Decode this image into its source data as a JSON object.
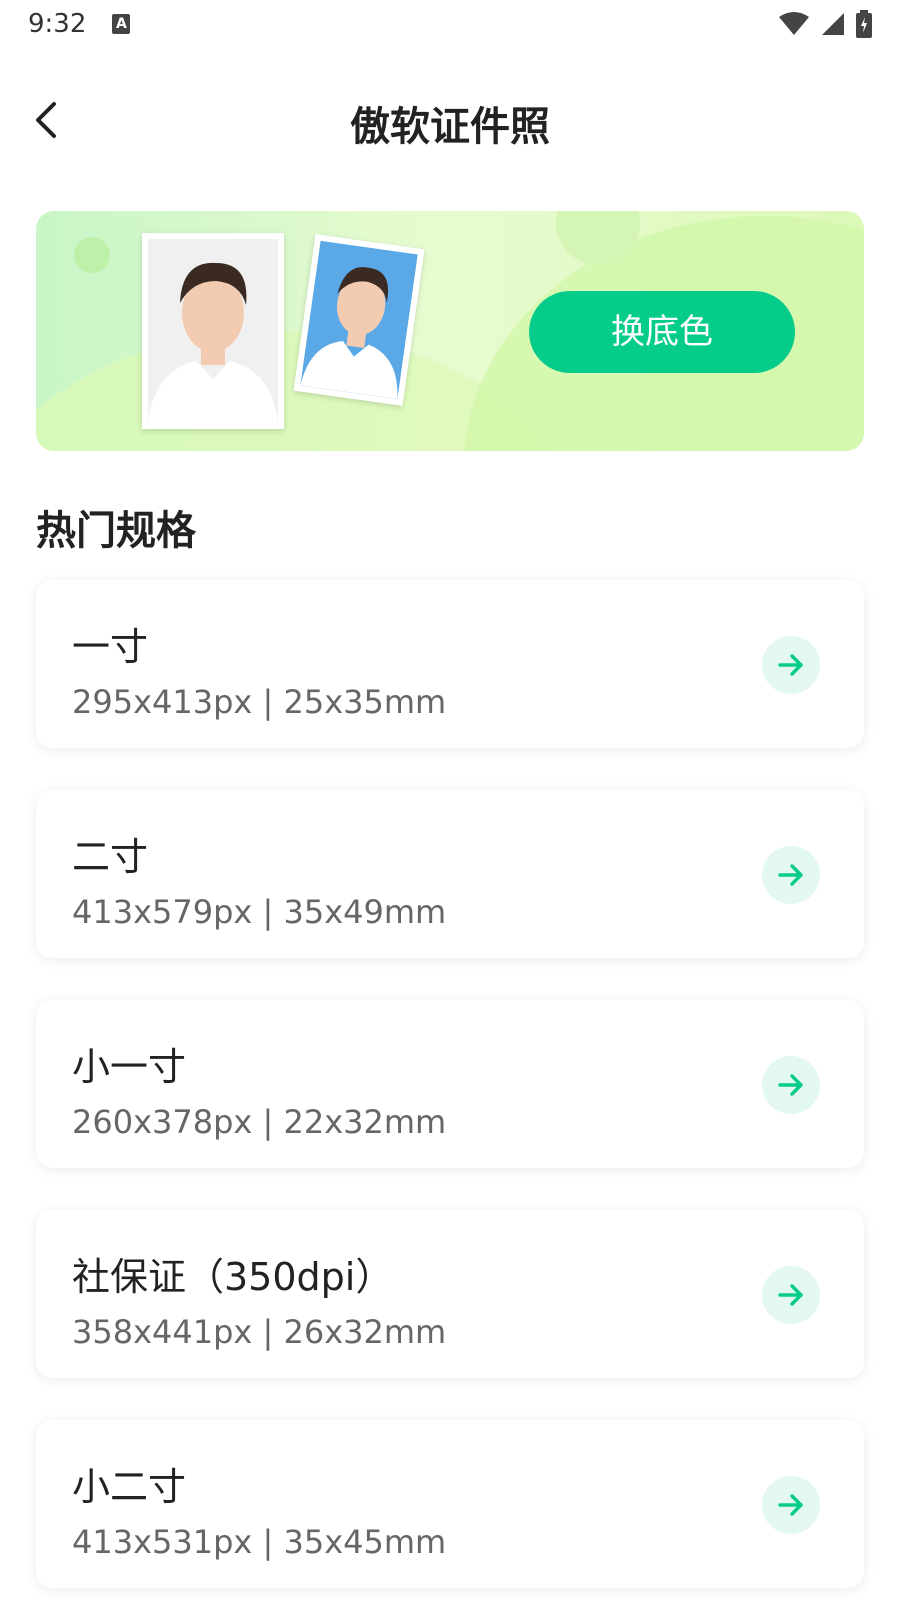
{
  "status_bar": {
    "time": "9:32",
    "notification_icon": "a-icon",
    "icons": [
      "wifi-icon",
      "signal-icon",
      "battery-charging-icon"
    ]
  },
  "header": {
    "title": "傲软证件照",
    "back_icon": "chevron-left-icon"
  },
  "banner": {
    "button_label": "换底色",
    "accent_color": "#05cc8a"
  },
  "section": {
    "title": "热门规格"
  },
  "specs": [
    {
      "name": "一寸",
      "size": "295x413px | 25x35mm"
    },
    {
      "name": "二寸",
      "size": "413x579px | 35x49mm"
    },
    {
      "name": "小一寸",
      "size": "260x378px | 22x32mm"
    },
    {
      "name": "社保证（350dpi）",
      "size": "358x441px | 26x32mm"
    },
    {
      "name": "小二寸",
      "size": "413x531px | 35x45mm"
    }
  ]
}
